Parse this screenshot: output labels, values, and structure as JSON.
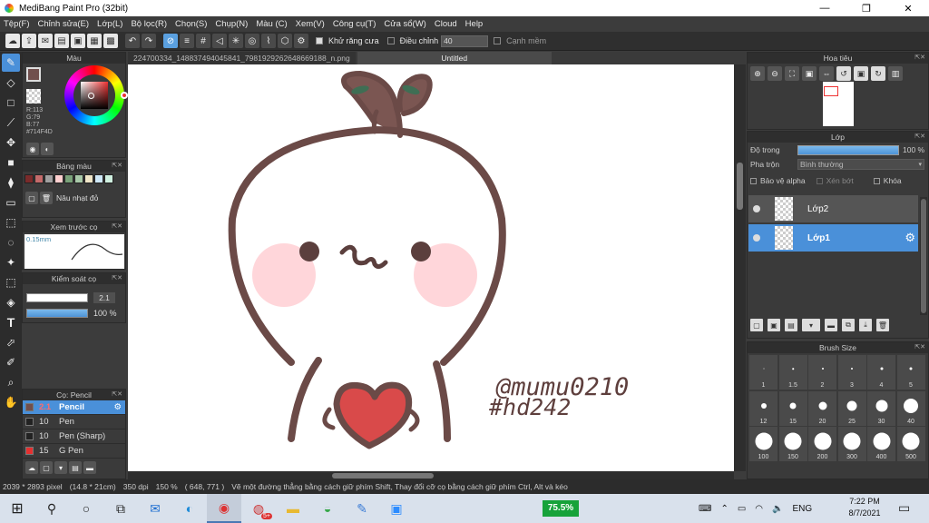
{
  "window": {
    "title": "MediBang Paint Pro (32bit)",
    "minimize": "—",
    "restore": "❐",
    "close": "✕"
  },
  "menu": [
    "Tệp(F)",
    "Chỉnh sửa(E)",
    "Lớp(L)",
    "Bộ lọc(R)",
    "Chọn(S)",
    "Chụp(N)",
    "Màu (C)",
    "Xem(V)",
    "Công cụ(T)",
    "Cửa sổ(W)",
    "Cloud",
    "Help"
  ],
  "toolbar": {
    "antialias_label": "Khử răng cưa",
    "correction_label": "Điều chỉnh",
    "correction_value": "40",
    "edge_label": "Cạnh mềm"
  },
  "color_panel": {
    "title": "Màu",
    "r": "R:113",
    "g": "G:79",
    "b": "B:77",
    "hex": "#714F4D",
    "main_color": "#714f4d"
  },
  "palette_panel": {
    "title": "Bảng màu",
    "colors": [
      "#7a2b2b",
      "#c46b6b",
      "#a0a0a0",
      "#ffd0d0",
      "#7aa27a",
      "#a8c8a8",
      "#f0e6c8",
      "#cfe8f8",
      "#d0f0e0"
    ],
    "action_label": "Nâu nhạt đỏ"
  },
  "preview_panel": {
    "title": "Xem trước cọ",
    "size_label": "0.15mm"
  },
  "brush_control": {
    "title": "Kiểm soát cọ",
    "size": "2.1",
    "opacity": "100 %",
    "opacity_fraction": 1.0
  },
  "brush_panel": {
    "title": "Cọ: Pencil",
    "items": [
      {
        "size": "2.1",
        "name": "Pencil",
        "chip": "#714f4d"
      },
      {
        "size": "10",
        "name": "Pen",
        "chip": "#222222"
      },
      {
        "size": "10",
        "name": "Pen (Sharp)",
        "chip": "#222222"
      },
      {
        "size": "15",
        "name": "G Pen",
        "chip": "#e53030"
      }
    ]
  },
  "tabs": [
    {
      "label": "224700334_148837494045841_7981929262648669188_n.png"
    },
    {
      "label": "Untitled"
    }
  ],
  "canvas": {
    "signature_line1": "@mumu0210",
    "signature_line2": "#hd242"
  },
  "navigator": {
    "title": "Hoa tiêu"
  },
  "layer_panel": {
    "title": "Lớp",
    "opacity_label": "Độ trong",
    "opacity_value": "100 %",
    "opacity_fraction": 1.0,
    "blend_label": "Pha trộn",
    "blend_value": "Bình thường",
    "protect_alpha": "Bảo vệ alpha",
    "clipping": "Xén bớt",
    "lock": "Khóa",
    "layers": [
      {
        "name": "Lớp2",
        "selected": false
      },
      {
        "name": "Lớp1",
        "selected": true
      }
    ]
  },
  "brush_size_panel": {
    "title": "Brush Size",
    "sizes": [
      "1",
      "1.5",
      "2",
      "3",
      "4",
      "5",
      "12",
      "15",
      "20",
      "25",
      "30",
      "40",
      "100",
      "150",
      "200",
      "300",
      "400",
      "500"
    ]
  },
  "status": {
    "pixels": "2039 * 2893 pixel",
    "physical": "(14.8 * 21cm)",
    "dpi": "350 dpi",
    "zoom": "150 %",
    "coords": "( 648, 771 )",
    "hint": "Vẽ một đường thẳng bằng cách giữ phím Shift, Thay đổi cỡ cọ bằng cách giữ phím Ctrl, Alt và kéo"
  },
  "taskbar": {
    "battery": "75.5%",
    "language": "ENG",
    "time": "7:22 PM",
    "date": "8/7/2021",
    "badge": "5+"
  }
}
